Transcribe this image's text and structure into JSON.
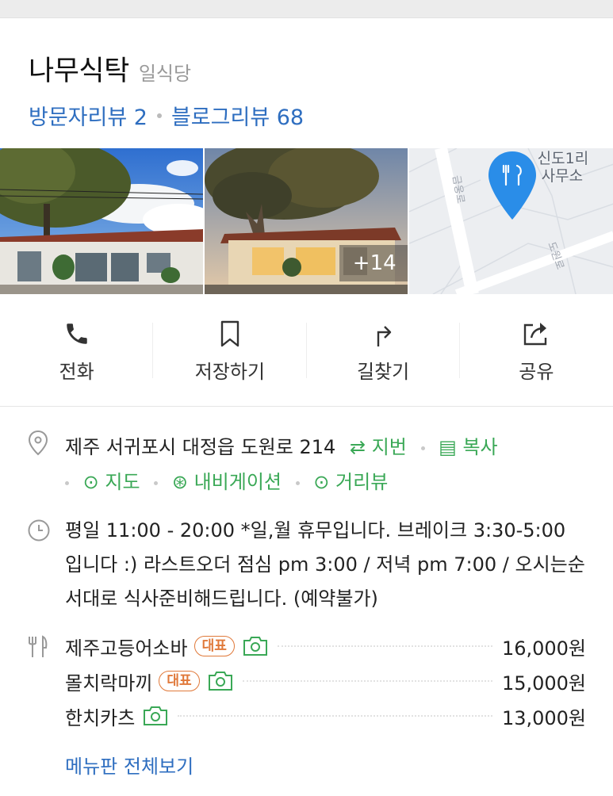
{
  "place": {
    "name": "나무식탁",
    "category": "일식당",
    "visitor_reviews": "방문자리뷰 2",
    "blog_reviews": "블로그리뷰 68"
  },
  "photos": {
    "extra_count": "+14",
    "map_label_line1": "신도1리",
    "map_label_line2": "사무소",
    "map_road_1": "금웅로",
    "map_road_2": "도원로"
  },
  "actions": [
    {
      "label": "전화",
      "icon": "phone-icon"
    },
    {
      "label": "저장하기",
      "icon": "bookmark-icon"
    },
    {
      "label": "길찾기",
      "icon": "directions-icon"
    },
    {
      "label": "공유",
      "icon": "share-icon"
    }
  ],
  "address": {
    "text": "제주 서귀포시 대정읍 도원로 214",
    "jibun_label": "지번",
    "copy_label": "복사",
    "map_label": "지도",
    "nav_label": "내비게이션",
    "street_label": "거리뷰"
  },
  "hours": {
    "text": "평일 11:00 - 20:00 *일,월 휴무입니다. 브레이크 3:30-5:00 입니다 :) 라스트오더 점심 pm 3:00 / 저녁 pm 7:00 / 오시는순서대로 식사준비해드립니다. (예약불가)"
  },
  "menu": {
    "items": [
      {
        "name": "제주고등어소바",
        "badge": "대표",
        "price": "16,000원"
      },
      {
        "name": "몰치락마끼",
        "badge": "대표",
        "price": "15,000원"
      },
      {
        "name": "한치카츠",
        "badge": "",
        "price": "13,000원"
      }
    ],
    "view_all": "메뉴판 전체보기"
  },
  "colors": {
    "link_blue": "#2e6ec0",
    "green": "#3aa856",
    "badge_orange": "#e0793a",
    "map_pin_blue": "#2a8de8"
  }
}
